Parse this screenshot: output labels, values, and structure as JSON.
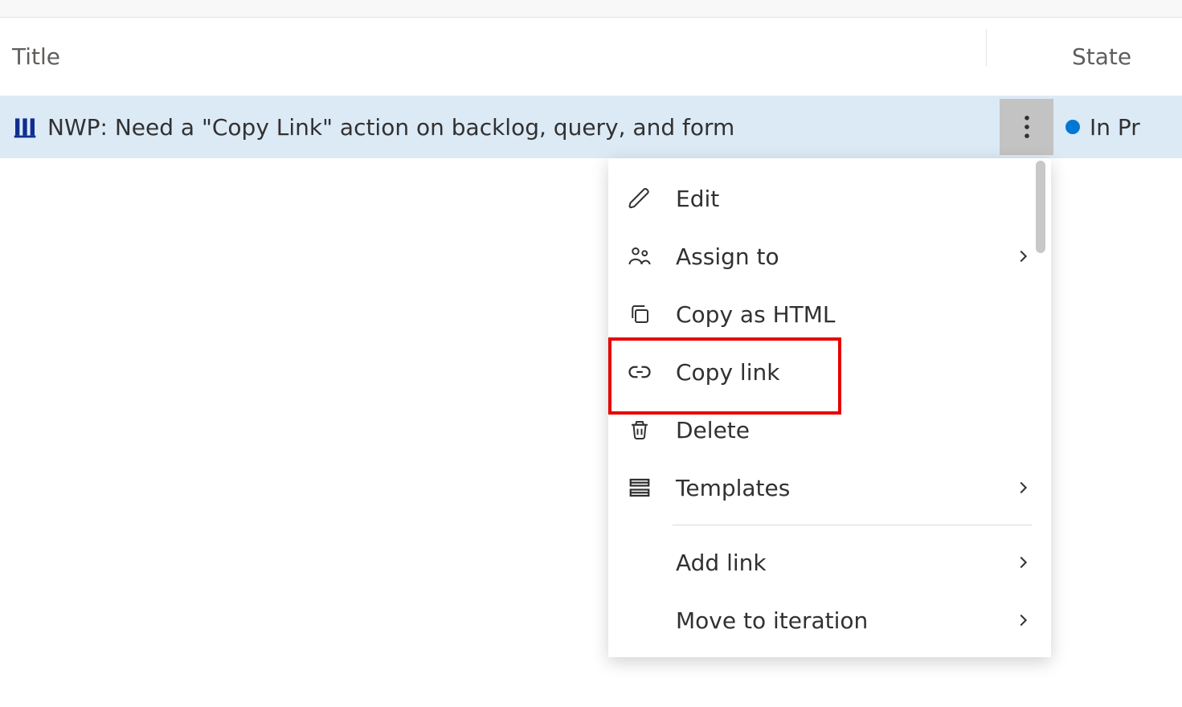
{
  "header": {
    "title_label": "Title",
    "state_label": "State"
  },
  "item": {
    "title": "NWP: Need a \"Copy Link\" action on backlog, query, and form",
    "state": "In Pr",
    "state_color": "#0078d4"
  },
  "menu": {
    "edit": "Edit",
    "assign_to": "Assign to",
    "copy_html": "Copy as HTML",
    "copy_link": "Copy link",
    "delete": "Delete",
    "templates": "Templates",
    "add_link": "Add link",
    "move_iteration": "Move to iteration"
  },
  "highlight_target": "menu-item-copy-link"
}
